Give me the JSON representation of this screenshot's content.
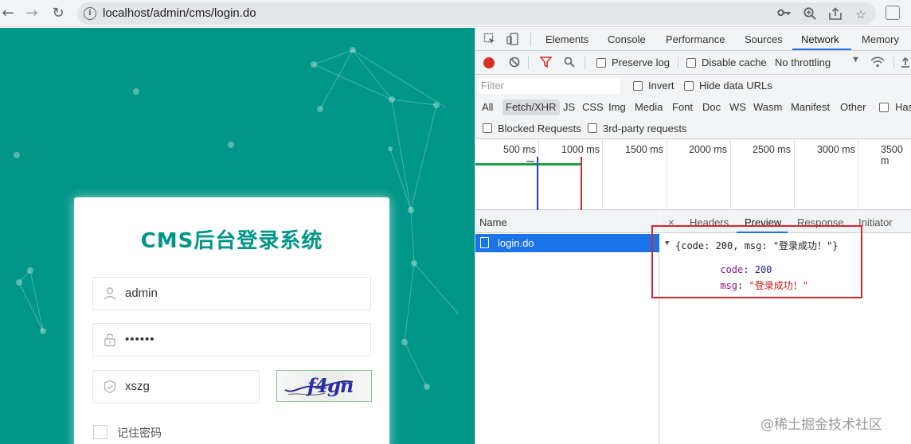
{
  "browser": {
    "url": "localhost/admin/cms/login.do",
    "icons": [
      "back-arrow-icon",
      "forward-arrow-icon",
      "reload-icon",
      "info-icon",
      "key-icon",
      "zoom-icon",
      "share-icon",
      "star-icon",
      "extension-icon"
    ]
  },
  "login": {
    "title": "CMS后台登录系统",
    "username_value": "admin",
    "password_value": "••••••",
    "captcha_input_value": "xszg",
    "captcha_text": "f4gn",
    "remember_label": "记住密码",
    "accent_color": "#009688"
  },
  "devtools": {
    "tabs": [
      "Elements",
      "Console",
      "Performance",
      "Sources",
      "Network",
      "Memory"
    ],
    "active_tab": "Network",
    "toolbar": {
      "preserve_log": "Preserve log",
      "disable_cache": "Disable cache",
      "throttling": "No throttling"
    },
    "filter": {
      "placeholder": "Filter",
      "invert": "Invert",
      "hide_data_urls": "Hide data URLs"
    },
    "types": [
      "All",
      "Fetch/XHR",
      "JS",
      "CSS",
      "Img",
      "Media",
      "Font",
      "Doc",
      "WS",
      "Wasm",
      "Manifest",
      "Other",
      "Has"
    ],
    "active_type": "Fetch/XHR",
    "blocked_requests": "Blocked Requests",
    "third_party": "3rd-party requests",
    "timeline_labels": [
      "500 ms",
      "1000 ms",
      "1500 ms",
      "2000 ms",
      "2500 ms",
      "3000 ms",
      "3500 m"
    ],
    "name_header": "Name",
    "request_name": "login.do",
    "detail_tabs": [
      "×",
      "Headers",
      "Preview",
      "Response",
      "Initiator"
    ],
    "active_detail_tab": "Preview",
    "preview": {
      "summary": "{code: 200, msg: \"登录成功！\"}",
      "code_key": "code",
      "code_value": "200",
      "msg_key": "msg",
      "msg_value": "\"登录成功！\""
    }
  },
  "watermark": "@稀土掘金技术社区"
}
